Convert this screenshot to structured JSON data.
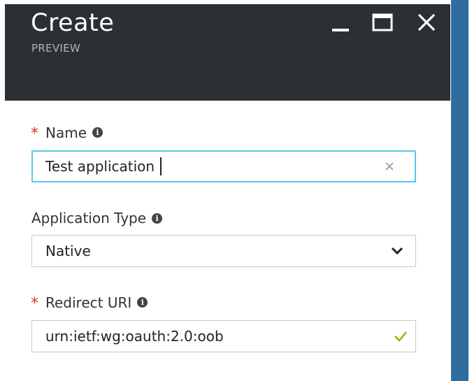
{
  "blade": {
    "title": "Create",
    "subtitle": "PREVIEW"
  },
  "window_controls": {
    "minimize_icon": "minimize-icon",
    "maximize_icon": "maximize-icon",
    "close_icon": "close-icon"
  },
  "fields": {
    "name": {
      "required_mark": "*",
      "label": "Name",
      "value": "Test application",
      "clear_icon": "clear-icon"
    },
    "application_type": {
      "label": "Application Type",
      "value": "Native",
      "dropdown_icon": "chevron-down-icon"
    },
    "redirect_uri": {
      "required_mark": "*",
      "label": "Redirect URI",
      "value": "urn:ietf:wg:oauth:2.0:oob",
      "valid_icon": "checkmark-icon"
    }
  },
  "colors": {
    "header_bg": "#2b3034",
    "accent_strip": "#2f6d9e",
    "focus_border": "#5cc6e9",
    "required": "#d13438",
    "valid_check": "#7fba00"
  }
}
